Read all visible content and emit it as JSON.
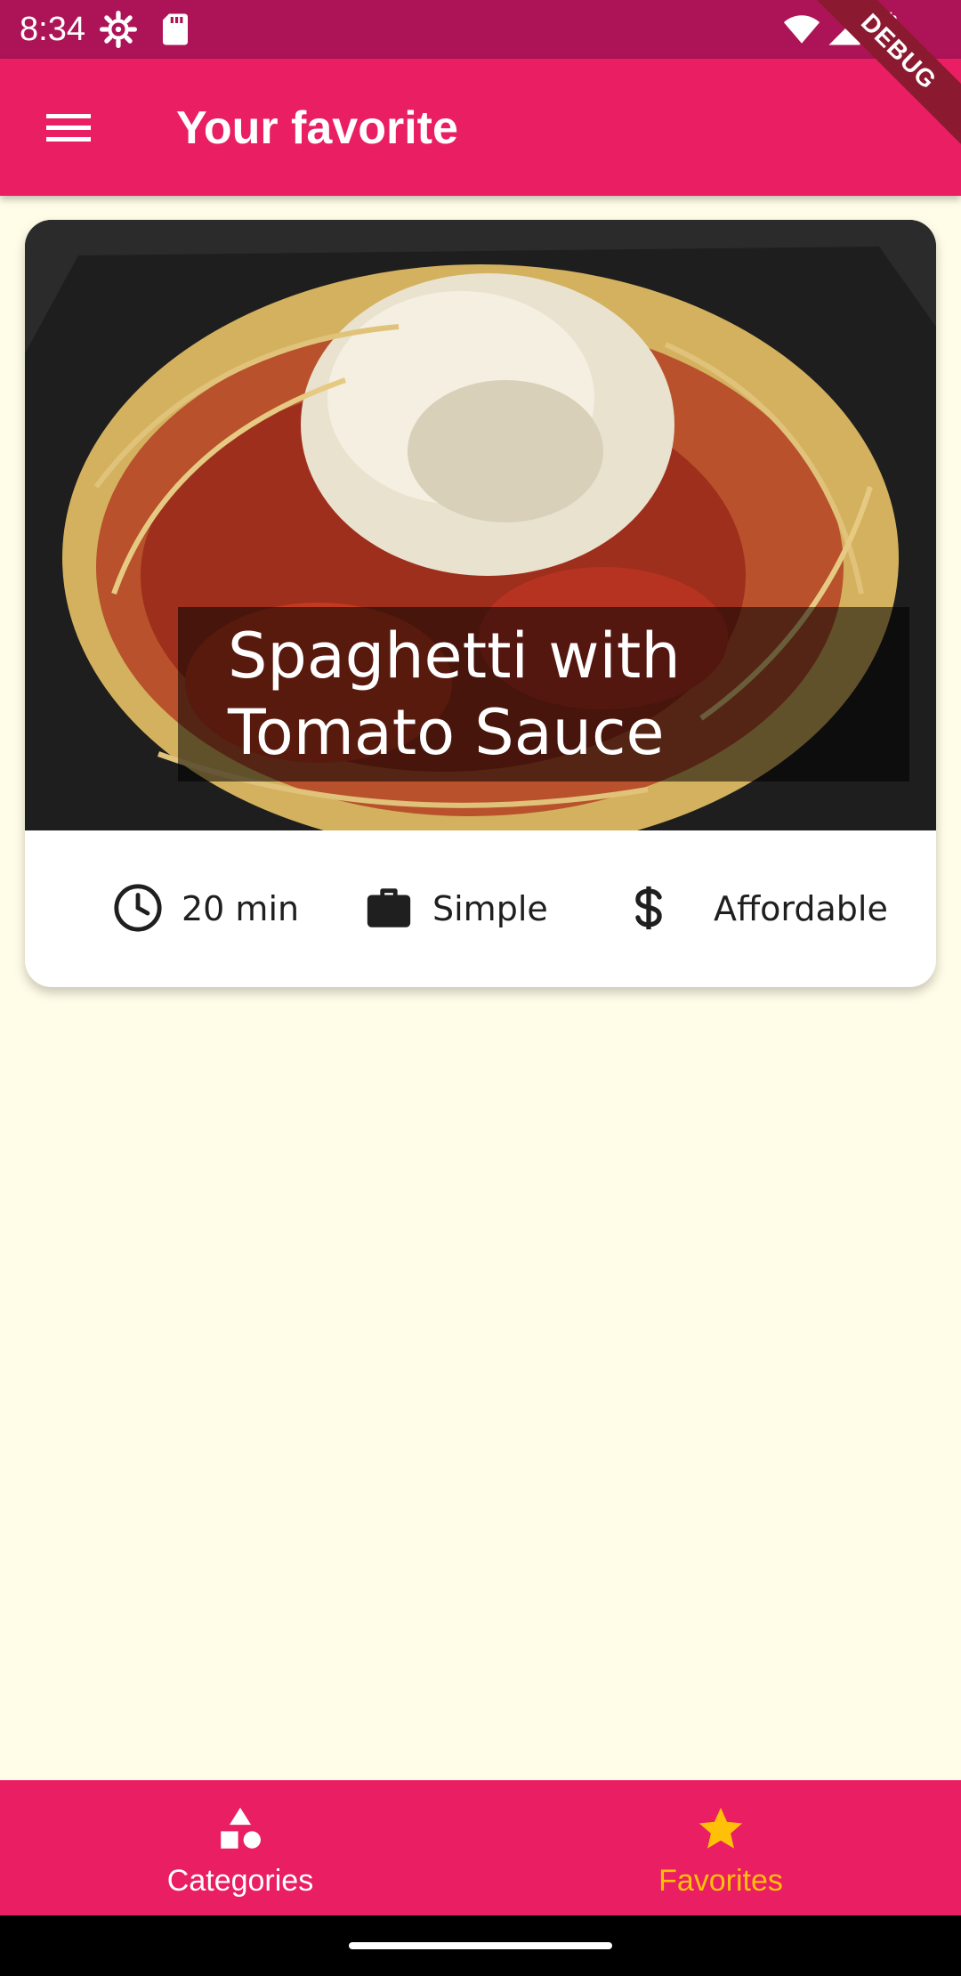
{
  "status_bar": {
    "time": "8:34",
    "icons": [
      "settings-icon",
      "sd-card-icon",
      "wifi-icon",
      "signal-icon",
      "battery-icon"
    ]
  },
  "debug_banner": {
    "label": "DEBUG"
  },
  "app_bar": {
    "title": "Your favorite",
    "menu_icon": "menu-icon"
  },
  "recipe": {
    "title": "Spaghetti with Tomato Sauce",
    "duration": "20 min",
    "complexity": "Simple",
    "affordability": "Affordable",
    "icons": {
      "duration": "clock-icon",
      "complexity": "briefcase-icon",
      "affordability": "dollar-icon"
    }
  },
  "bottom_nav": {
    "items": [
      {
        "label": "Categories",
        "icon": "categories-icon",
        "active": false
      },
      {
        "label": "Favorites",
        "icon": "star-icon",
        "active": true
      }
    ]
  },
  "colors": {
    "primary": "#E91E63",
    "primary_dark": "#AD1457",
    "accent": "#FFC107",
    "background": "#FFFDE7"
  }
}
